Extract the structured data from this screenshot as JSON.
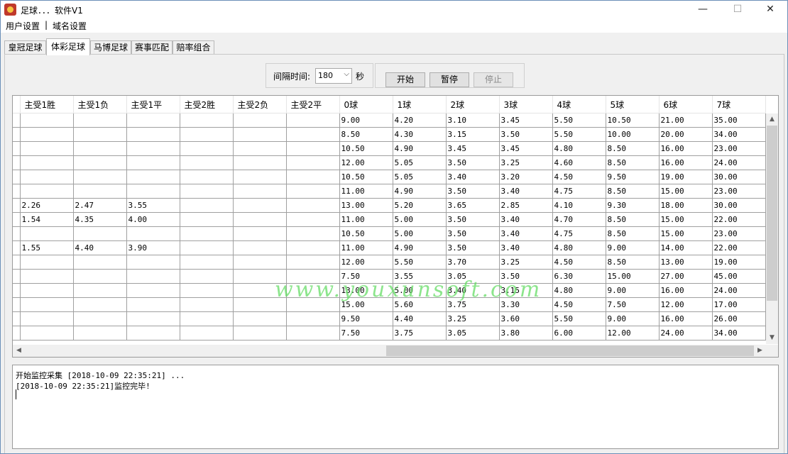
{
  "window": {
    "title": "足球．．．软件V1",
    "controls": {
      "minimize": "—",
      "maximize": "☐",
      "close": "✕"
    }
  },
  "menu": {
    "items": [
      "用户设置",
      "|",
      "域名设置"
    ]
  },
  "tabs": [
    "皇冠足球",
    "体彩足球",
    "马博足球",
    "赛事匹配",
    "赔率组合"
  ],
  "active_tab": 1,
  "controls": {
    "interval_label": "间隔时间:",
    "interval_value": "180",
    "interval_unit": "秒",
    "start": "开始",
    "pause": "暂停",
    "stop": "停止"
  },
  "grid": {
    "columns": [
      "主受1胜",
      "主受1负",
      "主受1平",
      "主受2胜",
      "主受2负",
      "主受2平",
      "0球",
      "1球",
      "2球",
      "3球",
      "4球",
      "5球",
      "6球",
      "7球"
    ],
    "rows": [
      [
        "",
        "",
        "",
        "",
        "",
        "",
        "9.00",
        "4.20",
        "3.10",
        "3.45",
        "5.50",
        "10.50",
        "21.00",
        "35.00"
      ],
      [
        "",
        "",
        "",
        "",
        "",
        "",
        "8.50",
        "4.30",
        "3.15",
        "3.50",
        "5.50",
        "10.00",
        "20.00",
        "34.00"
      ],
      [
        "",
        "",
        "",
        "",
        "",
        "",
        "10.50",
        "4.90",
        "3.45",
        "3.45",
        "4.80",
        "8.50",
        "16.00",
        "23.00"
      ],
      [
        "",
        "",
        "",
        "",
        "",
        "",
        "12.00",
        "5.05",
        "3.50",
        "3.25",
        "4.60",
        "8.50",
        "16.00",
        "24.00"
      ],
      [
        "",
        "",
        "",
        "",
        "",
        "",
        "10.50",
        "5.05",
        "3.40",
        "3.20",
        "4.50",
        "9.50",
        "19.00",
        "30.00"
      ],
      [
        "",
        "",
        "",
        "",
        "",
        "",
        "11.00",
        "4.90",
        "3.50",
        "3.40",
        "4.75",
        "8.50",
        "15.00",
        "23.00"
      ],
      [
        "2.26",
        "2.47",
        "3.55",
        "",
        "",
        "",
        "13.00",
        "5.20",
        "3.65",
        "2.85",
        "4.10",
        "9.30",
        "18.00",
        "30.00"
      ],
      [
        "1.54",
        "4.35",
        "4.00",
        "",
        "",
        "",
        "11.00",
        "5.00",
        "3.50",
        "3.40",
        "4.70",
        "8.50",
        "15.00",
        "22.00"
      ],
      [
        "",
        "",
        "",
        "",
        "",
        "",
        "10.50",
        "5.00",
        "3.50",
        "3.40",
        "4.75",
        "8.50",
        "15.00",
        "23.00"
      ],
      [
        "1.55",
        "4.40",
        "3.90",
        "",
        "",
        "",
        "11.00",
        "4.90",
        "3.50",
        "3.40",
        "4.80",
        "9.00",
        "14.00",
        "22.00"
      ],
      [
        "",
        "",
        "",
        "",
        "",
        "",
        "12.00",
        "5.50",
        "3.70",
        "3.25",
        "4.50",
        "8.50",
        "13.00",
        "19.00"
      ],
      [
        "",
        "",
        "",
        "",
        "",
        "",
        "7.50",
        "3.55",
        "3.05",
        "3.50",
        "6.30",
        "15.00",
        "27.00",
        "45.00"
      ],
      [
        "",
        "",
        "",
        "",
        "",
        "",
        "13.00",
        "5.00",
        "3.40",
        "3.15",
        "4.80",
        "9.00",
        "16.00",
        "24.00"
      ],
      [
        "",
        "",
        "",
        "",
        "",
        "",
        "15.00",
        "5.60",
        "3.75",
        "3.30",
        "4.50",
        "7.50",
        "12.00",
        "17.00"
      ],
      [
        "",
        "",
        "",
        "",
        "",
        "",
        "9.50",
        "4.40",
        "3.25",
        "3.60",
        "5.50",
        "9.00",
        "16.00",
        "26.00"
      ],
      [
        "",
        "",
        "",
        "",
        "",
        "",
        "7.50",
        "3.75",
        "3.05",
        "3.80",
        "6.00",
        "12.00",
        "24.00",
        "34.00"
      ]
    ]
  },
  "watermark": "www.youxunsoft.com",
  "log": {
    "lines": [
      "开始监控采集 [2018-10-09 22:35:21] ...",
      "[2018-10-09 22:35:21]监控完毕!"
    ]
  }
}
